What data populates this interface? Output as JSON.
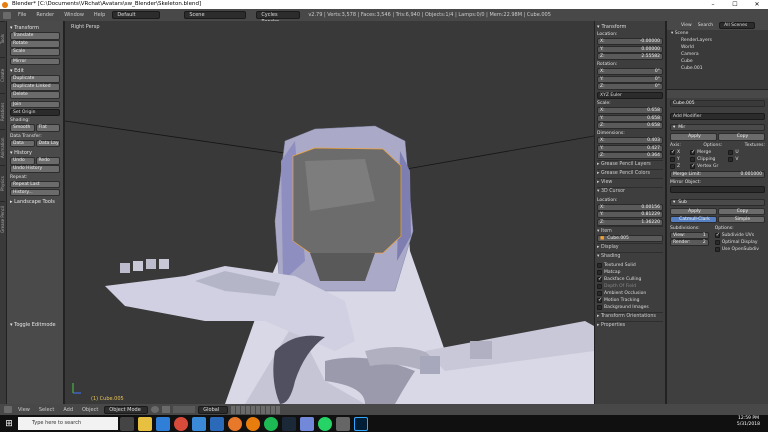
{
  "window": {
    "title": "Blender* [C:\\Documents\\VRchat\\Avatars\\sw_Blender\\Skeleton.blend]"
  },
  "topbar": {
    "menus": [
      "File",
      "Render",
      "Window",
      "Help"
    ],
    "layout": "Default",
    "scene": "Scene",
    "engine": "Cycles Render",
    "stats": "v2.79 | Verts:3,578 | Faces:3,546 | Tris:6,940 | Objects:1/4 | Lamps:0/0 | Mem:22.98M | Cube.005"
  },
  "toolshelf": {
    "tabs": [
      "Tools",
      "Create",
      "Relations",
      "Animation",
      "Physics",
      "Grease Pencil"
    ],
    "transform_title": "Transform",
    "translate": "Translate",
    "rotate": "Rotate",
    "scale": "Scale",
    "mirror": "Mirror",
    "edit_title": "Edit",
    "duplicate": "Duplicate",
    "duplicate_linked": "Duplicate Linked",
    "delete": "Delete",
    "join": "Join",
    "set_origin": "Set Origin",
    "shading_label": "Shading:",
    "smooth": "Smooth",
    "flat": "Flat",
    "data_transfer_label": "Data Transfer:",
    "data": "Data",
    "data_lay": "Data Lay",
    "history_title": "History",
    "undo": "Undo",
    "redo": "Redo",
    "undo_history": "Undo History",
    "repeat_label": "Repeat:",
    "repeat_last": "Repeat Last",
    "history_btn": "History...",
    "landscape": "Landscape Tools",
    "toggle_editmode": "Toggle Editmode"
  },
  "viewport": {
    "label": "Right Persp",
    "object_label": "(1) Cube.005"
  },
  "npanel": {
    "transform_title": "Transform",
    "location_label": "Location:",
    "location": [
      {
        "axis": "X:",
        "value": "-0.00000"
      },
      {
        "axis": "Y:",
        "value": "0.00000"
      },
      {
        "axis": "Z:",
        "value": "2.55582"
      }
    ],
    "rotation_label": "Rotation:",
    "rotation": [
      {
        "axis": "X:",
        "value": "0°"
      },
      {
        "axis": "Y:",
        "value": "0°"
      },
      {
        "axis": "Z:",
        "value": "0°"
      }
    ],
    "rotation_mode": "XYZ Euler",
    "scale_label": "Scale:",
    "scale": [
      {
        "axis": "X:",
        "value": "0.658"
      },
      {
        "axis": "Y:",
        "value": "0.658"
      },
      {
        "axis": "Z:",
        "value": "0.658"
      }
    ],
    "dimensions_label": "Dimensions:",
    "dimensions": [
      {
        "axis": "X:",
        "value": "0.403"
      },
      {
        "axis": "Y:",
        "value": "0.427"
      },
      {
        "axis": "Z:",
        "value": "0.364"
      }
    ],
    "grease_layers": "Grease Pencil Layers",
    "grease_colors": "Grease Pencil Colors",
    "view": "View",
    "cursor_title": "3D Cursor",
    "cursor_location_label": "Location:",
    "cursor": [
      {
        "axis": "X:",
        "value": "0.00156"
      },
      {
        "axis": "Y:",
        "value": "0.81229"
      },
      {
        "axis": "Z:",
        "value": "1.36220"
      }
    ],
    "item_title": "Item",
    "item_name": "Cube.005",
    "display": "Display",
    "shading_title": "Shading",
    "textured_solid": "Textured Solid",
    "matcap": "Matcap",
    "backface_culling": "Backface Culling",
    "depth_of_field": "Depth Of Field",
    "ambient_occlusion": "Ambient Occlusion",
    "motion_tracking": "Motion Tracking",
    "background_images": "Background Images",
    "transform_orientations": "Transform Orientations",
    "properties": "Properties"
  },
  "outliner": {
    "view": "View",
    "search": "Search",
    "all_scenes": "All Scenes",
    "items": [
      "Scene",
      "RenderLayers",
      "World",
      "Camera",
      "Cube",
      "Cube.001"
    ]
  },
  "props": {
    "object_name": "Cube.005",
    "add_modifier": "Add Modifier",
    "mir_label": "Mir",
    "apply": "Apply",
    "copy": "Copy",
    "axis_label": "Axis:",
    "options_label": "Options:",
    "textures_label": "Textures:",
    "x": "X",
    "y": "Y",
    "z": "Z",
    "merge": "Merge",
    "clipping": "Clipping",
    "vertex_gr": "Vertex Gr",
    "u": "U",
    "v": "V",
    "merge_limit_label": "Merge Limit:",
    "merge_limit": "0.001000",
    "mirror_object": "Mirror Object:",
    "sub_label": "Sub",
    "catmull": "Catmull-Clark",
    "simple": "Simple",
    "subdivisions": "Subdivisions:",
    "options2": "Options:",
    "view_label": "View:",
    "view_value": "1",
    "render_label": "Render:",
    "render_value": "2",
    "subdivide_uvs": "Subdivide UVs",
    "optimal_display": "Optimal Display",
    "use_opensubdiv": "Use OpenSubdiv"
  },
  "bottombar": {
    "view": "View",
    "select": "Select",
    "add": "Add",
    "object": "Object",
    "mode": "Object Mode",
    "orientation": "Global"
  },
  "taskbar": {
    "search_placeholder": "Type here to search",
    "time": "12:59 PM",
    "date": "5/31/2018"
  }
}
